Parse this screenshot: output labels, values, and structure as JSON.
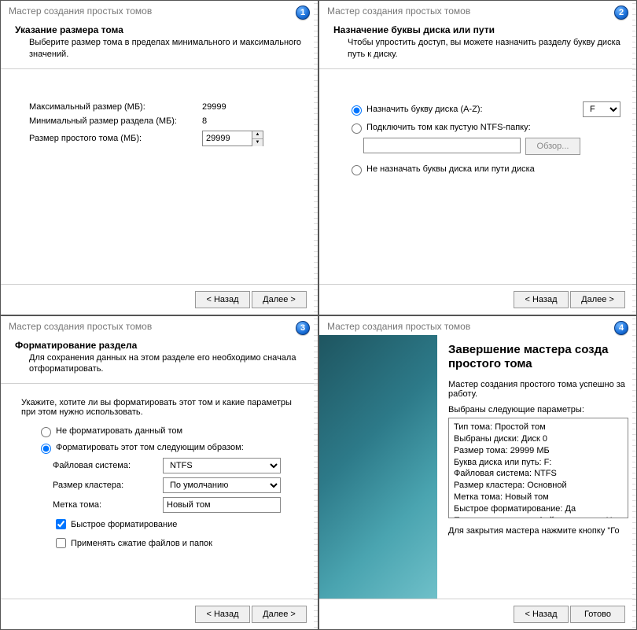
{
  "wizard_title": "Мастер создания простых томов",
  "buttons": {
    "back": "< Назад",
    "next": "Далее >",
    "finish": "Готово",
    "browse": "Обзор..."
  },
  "badges": {
    "b1": "1",
    "b2": "2",
    "b3": "3",
    "b4": "4"
  },
  "pane1": {
    "title": "Указание размера тома",
    "desc": "Выберите размер тома в пределах минимального и максимального значений.",
    "max_label": "Максимальный размер (МБ):",
    "max_value": "29999",
    "min_label": "Минимальный размер раздела (МБ):",
    "min_value": "8",
    "size_label": "Размер простого тома (МБ):",
    "size_value": "29999"
  },
  "pane2": {
    "title": "Назначение буквы диска или пути",
    "desc": "Чтобы упростить доступ, вы можете назначить разделу букву диска путь к диску.",
    "opt_letter": "Назначить букву диска (A-Z):",
    "letter_value": "F",
    "opt_mount": "Подключить том как пустую NTFS-папку:",
    "mount_path": "",
    "opt_none": "Не назначать буквы диска или пути диска"
  },
  "pane3": {
    "title": "Форматирование раздела",
    "desc": "Для сохранения данных на этом разделе его необходимо сначала отформатировать.",
    "intro": "Укажите, хотите ли вы форматировать этот том и какие параметры при этом нужно использовать.",
    "opt_noformat": "Не форматировать данный том",
    "opt_format": "Форматировать этот том следующим образом:",
    "fs_label": "Файловая система:",
    "fs_value": "NTFS",
    "cluster_label": "Размер кластера:",
    "cluster_value": "По умолчанию",
    "vollabel_label": "Метка тома:",
    "vollabel_value": "Новый том",
    "chk_quick": "Быстрое форматирование",
    "chk_compress": "Применять сжатие файлов и папок"
  },
  "pane4": {
    "title_l1": "Завершение мастера созда",
    "title_l2": "простого тома",
    "done_msg": "Мастер создания простого тома успешно за работу.",
    "params_intro": "Выбраны следующие параметры:",
    "summary": [
      "Тип тома: Простой том",
      "Выбраны диски: Диск 0",
      "Размер тома: 29999 МБ",
      "Буква диска или путь: F:",
      "Файловая система: NTFS",
      "Размер кластера: Основной",
      "Метка тома: Новый том",
      "Быстрое форматирование: Да",
      "Применение сжатия файлов и папок: Нет"
    ],
    "close_msg": "Для закрытия мастера нажмите кнопку \"Го"
  }
}
